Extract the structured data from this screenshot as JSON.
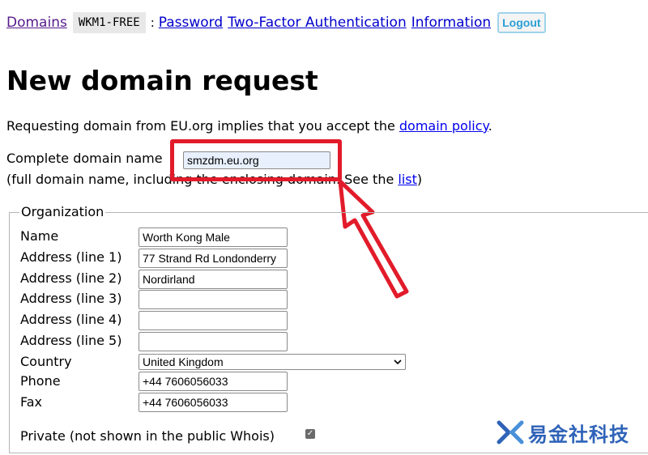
{
  "nav": {
    "domains": "Domains",
    "handle": "WKM1-FREE",
    "separator": ":",
    "password": "Password",
    "two_factor": "Two-Factor Authentication",
    "information": "Information",
    "logout": "Logout"
  },
  "page_title": "New domain request",
  "intro": {
    "prefix": "Requesting domain from EU.org implies that you accept the ",
    "link": "domain policy",
    "suffix": "."
  },
  "domain": {
    "label": "Complete domain name",
    "value": "smzdm.eu.org",
    "hint_prefix": "(full domain name, including the enclosing domain. See the ",
    "hint_link": "list",
    "hint_suffix": ")"
  },
  "org": {
    "legend": "Organization",
    "name_label": "Name",
    "name_value": "Worth Kong Male",
    "addr1_label": "Address (line 1)",
    "addr1_value": "77 Strand Rd Londonderry",
    "addr2_label": "Address (line 2)",
    "addr2_value": "Nordirland",
    "addr3_label": "Address (line 3)",
    "addr3_value": "",
    "addr4_label": "Address (line 4)",
    "addr4_value": "",
    "addr5_label": "Address (line 5)",
    "addr5_value": "",
    "country_label": "Country",
    "country_value": "United Kingdom",
    "phone_label": "Phone",
    "phone_value": "+44 7606056033",
    "fax_label": "Fax",
    "fax_value": "+44 7606056033",
    "private_label": "Private (not shown in the public Whois)",
    "private_checked": true
  },
  "watermark": {
    "text": "易金社科技",
    "icon": "logo-x-icon"
  },
  "colors": {
    "highlight_red": "#e21b2a",
    "link_blue": "#0000ee",
    "visited_purple": "#551a8b",
    "logout_blue": "#2a9fd6",
    "watermark_blue": "#2f63b8"
  }
}
